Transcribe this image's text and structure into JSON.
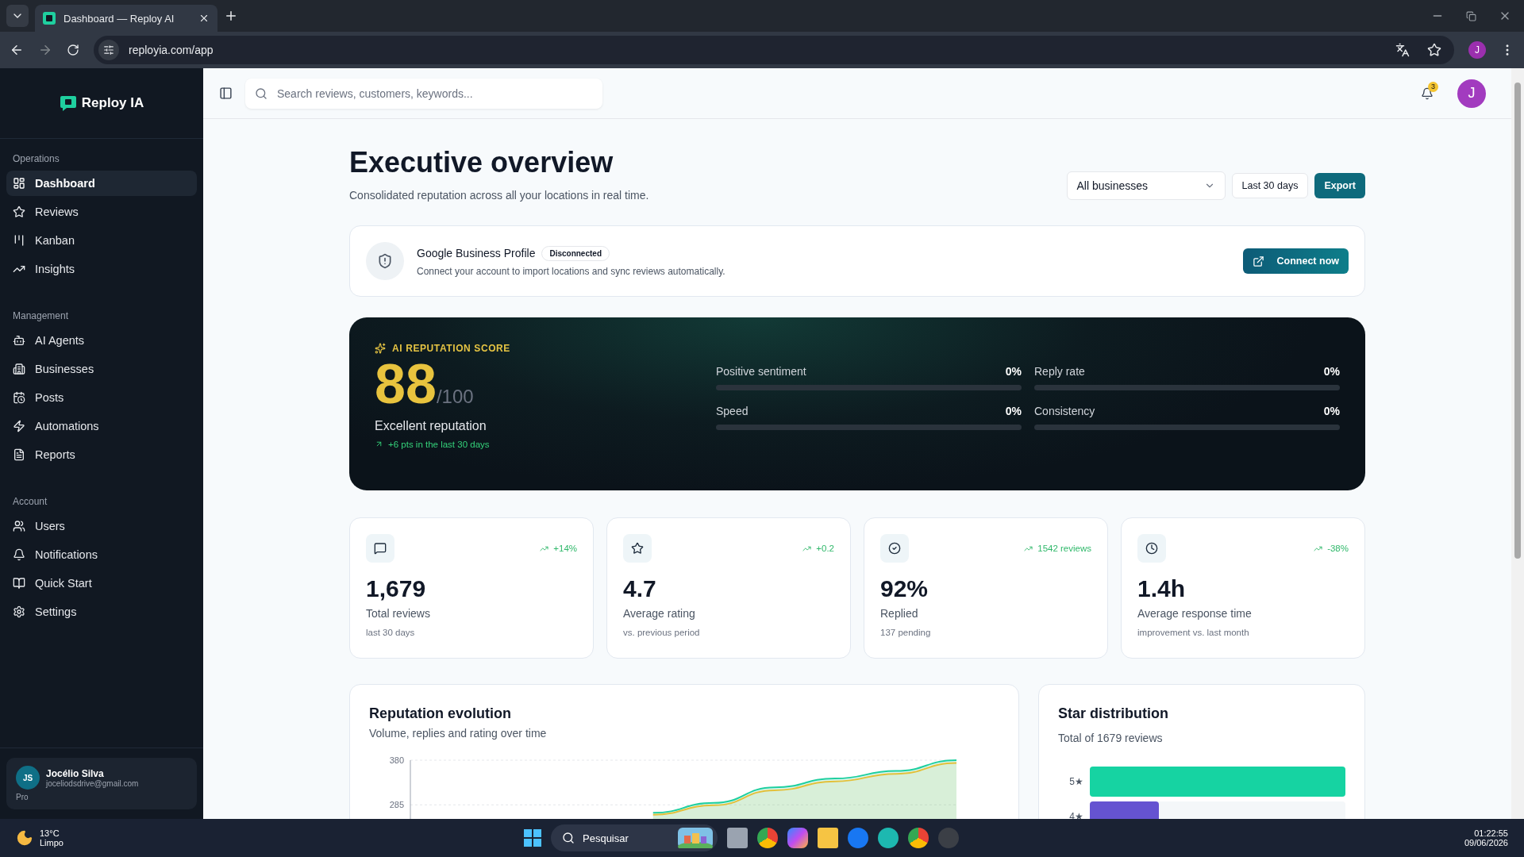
{
  "browser": {
    "tab_title": "Dashboard — Reploy AI",
    "address": "reployia.com/app",
    "profile_initial": "J"
  },
  "sidebar": {
    "logo": "Reploy IA",
    "sections": [
      {
        "title": "Operations",
        "items": [
          {
            "label": "Dashboard",
            "selected": true
          },
          {
            "label": "Reviews",
            "selected": false
          },
          {
            "label": "Kanban",
            "selected": false
          },
          {
            "label": "Insights",
            "selected": false
          }
        ]
      },
      {
        "title": "Management",
        "items": [
          {
            "label": "AI Agents",
            "selected": false
          },
          {
            "label": "Businesses",
            "selected": false
          },
          {
            "label": "Posts",
            "selected": false
          },
          {
            "label": "Automations",
            "selected": false
          },
          {
            "label": "Reports",
            "selected": false
          }
        ]
      },
      {
        "title": "Account",
        "items": [
          {
            "label": "Users",
            "selected": false
          },
          {
            "label": "Notifications",
            "selected": false
          },
          {
            "label": "Quick Start",
            "selected": false
          },
          {
            "label": "Settings",
            "selected": false
          }
        ]
      }
    ],
    "user": {
      "initials": "JS",
      "name": "Jocélio Silva",
      "email": "joceliodsdrive@gmail.com",
      "plan": "Pro"
    }
  },
  "topbar": {
    "search_placeholder": "Search reviews, customers, keywords...",
    "notification_count": "3",
    "avatar_initial": "J"
  },
  "header": {
    "title": "Executive overview",
    "subtitle": "Consolidated reputation across all your locations in real time.",
    "business_filter": "All businesses",
    "period": "Last 30 days",
    "export": "Export"
  },
  "integration": {
    "title": "Google Business Profile",
    "status": "Disconnected",
    "description": "Connect your account to import locations and sync reviews automatically.",
    "action": "Connect now"
  },
  "score": {
    "label": "AI REPUTATION SCORE",
    "value": "88",
    "max": "/100",
    "rating": "Excellent reputation",
    "trend": "+6 pts in the last 30 days",
    "metrics": [
      {
        "name": "Positive sentiment",
        "reading": "0%",
        "level": 0
      },
      {
        "name": "Reply rate",
        "reading": "0%",
        "level": 0
      },
      {
        "name": "Speed",
        "reading": "0%",
        "level": 0
      },
      {
        "name": "Consistency",
        "reading": "0%",
        "level": 0
      }
    ]
  },
  "stats": [
    {
      "trend": "+14%",
      "value": "1,679",
      "label": "Total reviews",
      "note": "last 30 days"
    },
    {
      "trend": "+0.2",
      "value": "4.7",
      "label": "Average rating",
      "note": "vs. previous period"
    },
    {
      "trend": "1542 reviews",
      "value": "92%",
      "label": "Replied",
      "note": "137 pending"
    },
    {
      "trend": "-38%",
      "value": "1.4h",
      "label": "Average response time",
      "note": "improvement vs. last month"
    }
  ],
  "reputation_chart": {
    "title": "Reputation evolution",
    "subtitle": "Volume, replies and rating over time",
    "chart_data": {
      "type": "area",
      "ylim": [
        255,
        380
      ],
      "yticks": [
        285,
        380
      ],
      "series": [
        {
          "color": "#1fcf9f",
          "values": [
            null,
            null,
            null,
            null,
            268,
            289,
            322,
            341,
            357,
            380
          ]
        },
        {
          "color": "#e3c03a",
          "values": [
            null,
            null,
            null,
            null,
            264,
            284,
            316,
            335,
            351,
            374
          ]
        }
      ]
    }
  },
  "star_distribution": {
    "title": "Star distribution",
    "subtitle": "Total of 1679 reviews",
    "bars": [
      {
        "label": "5★",
        "level": 1,
        "color": "#16d3a2"
      },
      {
        "label": "4★",
        "level": 0.27,
        "color": "#6553d1"
      }
    ]
  },
  "taskbar": {
    "temperature": "13°C",
    "condition": "Limpo",
    "search": "Pesquisar",
    "time": "01:22:55",
    "date": "09/06/2026"
  }
}
